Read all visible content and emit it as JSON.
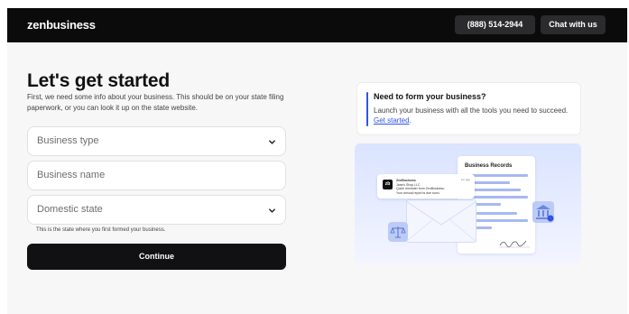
{
  "header": {
    "logo": "zenbusiness",
    "phone": "(888) 514-2944",
    "chat": "Chat with us"
  },
  "form": {
    "title": "Let's get started",
    "subtitle": "First, we need some info about your business. This should be on your state filing paperwork, or you can look it up on the state website.",
    "business_type_placeholder": "Business type",
    "business_name_placeholder": "Business name",
    "domestic_state_placeholder": "Domestic state",
    "state_hint": "This is the state where you first formed your business.",
    "continue_label": "Continue"
  },
  "info_card": {
    "heading": "Need to form your business?",
    "body": "Launch your business with all the tools you need to succeed.",
    "link": "Get started",
    "link_suffix": "."
  },
  "illustration": {
    "records_title": "Business Records",
    "notif_sender": "ZenBusiness",
    "notif_company": "Jane's Shop LLC",
    "notif_line1": "Quick reminder from ZenBusiness:",
    "notif_line2": "Your annual report is due soon.",
    "notif_time": "1m ago"
  },
  "colors": {
    "accent": "#2f55e4",
    "header_bg": "#0b0b0c",
    "button_bg": "#111113"
  }
}
